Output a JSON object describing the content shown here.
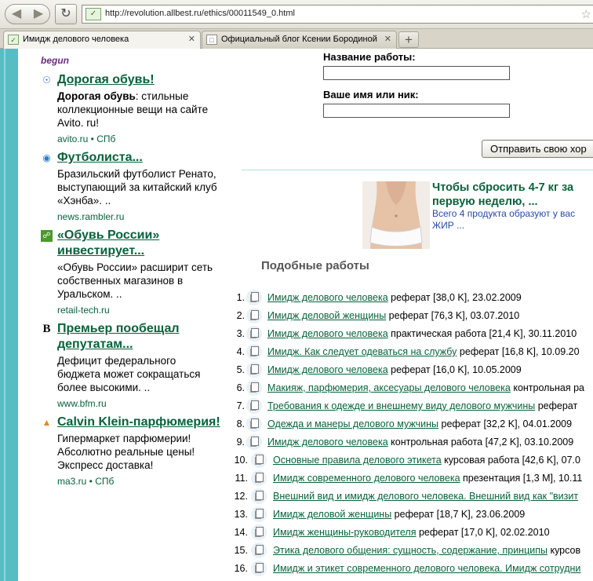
{
  "browser": {
    "url": "http://revolution.allbest.ru/ethics/00011549_0.html",
    "tabs": [
      {
        "title": "Имидж делового человека",
        "close": "✕"
      },
      {
        "title": "Официальный блог Ксении Бородиной",
        "close": "✕"
      }
    ],
    "new_tab": "+"
  },
  "ads": {
    "provider": "begun",
    "items": [
      {
        "icon": "spiral-icon",
        "title": "Дорогая обувь!",
        "bold": "Дорогая обувь",
        "text": ": стильные коллекционные вещи на сайте Avito. ru!",
        "source": "avito.ru  •  СПб"
      },
      {
        "icon": "globe-icon",
        "title": "Футболиста...",
        "bold": "",
        "text": "Бразильский футболист Ренато, выступающий за китайский клуб «Хэнба». ..",
        "source": "news.rambler.ru"
      },
      {
        "icon": "rss-icon",
        "title": "«Обувь России» инвестирует...",
        "bold": "",
        "text": "«Обувь России» расширит сеть собственных магазинов в Уральском. ..",
        "source": "retail-tech.ru"
      },
      {
        "icon": "bfm-icon",
        "title": "Премьер пообещал депутатам...",
        "bold": "",
        "text": "Дефицит федерального бюджета может сокращаться более высокими. ..",
        "source": "www.bfm.ru"
      },
      {
        "icon": "bottle-icon",
        "title": "Calvin Klein-парфюмерия!",
        "bold": "",
        "text": "Гипермаркет парфюмерии! Абсолютно реальные цены! Экспресс доставка!",
        "source": "ma3.ru  •  СПб"
      }
    ]
  },
  "form": {
    "work_title_label": "Название работы:",
    "name_label": "Ваше имя или ник:",
    "submit": "Отправить свою хор"
  },
  "promo": {
    "title": "Чтобы сбросить 4-7 кг за первую неделю, ...",
    "text": "Всего 4 продукта образуют у вас ЖИР ..."
  },
  "similar": {
    "heading": "Подобные работы",
    "items": [
      {
        "num": "1.",
        "title": "Имидж делового человека",
        "meta": " реферат [38,0 K], 23.02.2009"
      },
      {
        "num": "2.",
        "title": "Имидж деловой женщины",
        "meta": " реферат [76,3 K], 03.07.2010"
      },
      {
        "num": "3.",
        "title": "Имидж делового человека",
        "meta": " практическая работа [21,4 K], 30.11.2010"
      },
      {
        "num": "4.",
        "title": "Имидж. Как следует одеваться на службу",
        "meta": " реферат [16,8 K], 10.09.20"
      },
      {
        "num": "5.",
        "title": "Имидж делового человека",
        "meta": " реферат [16,0 K], 10.05.2009"
      },
      {
        "num": "6.",
        "title": "Макияж, парфюмерия, аксесуары делового человека",
        "meta": " контрольная ра"
      },
      {
        "num": "7.",
        "title": "Требования к одежде и внешнему виду делового мужчины",
        "meta": " реферат"
      },
      {
        "num": "8.",
        "title": "Одежда и манеры делового мужчины",
        "meta": " реферат [32,2 K], 04.01.2009"
      },
      {
        "num": "9.",
        "title": "Имидж делового человека",
        "meta": " контрольная работа [47,2 K], 03.10.2009"
      },
      {
        "num": "10.",
        "title": "Основные правила делового этикета",
        "meta": " курсовая работа [42,6 K], 07.0"
      },
      {
        "num": "11.",
        "title": "Имидж современного делового человека",
        "meta": " презентация [1,3 M], 10.11"
      },
      {
        "num": "12.",
        "title": "Внешний вид и имидж делового человека. Внешний вид как \"визит",
        "meta": ""
      },
      {
        "num": "13.",
        "title": "Имидж деловой женщины",
        "meta": " реферат [18,7 K], 23.06.2009"
      },
      {
        "num": "14.",
        "title": "Имидж женщины-руководителя",
        "meta": " реферат [17,0 K], 02.02.2010"
      },
      {
        "num": "15.",
        "title": "Этика делового общения: сущность, содержание, принципы",
        "meta": " курсов"
      },
      {
        "num": "16.",
        "title": "Имидж и этикет современного делового человека. Имидж сотрудни",
        "meta": ""
      }
    ]
  }
}
